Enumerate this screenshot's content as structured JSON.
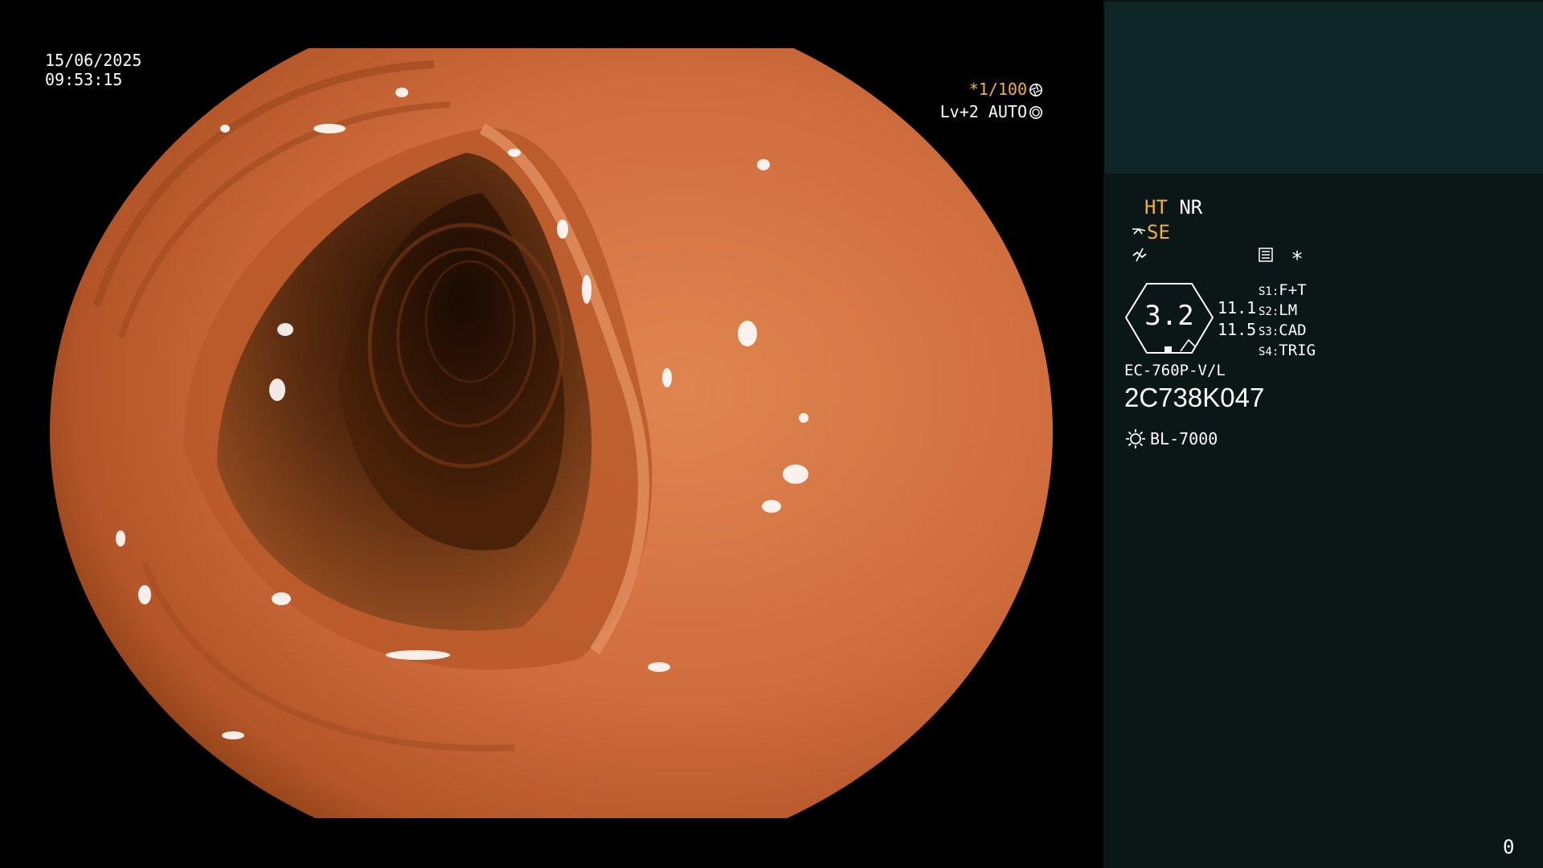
{
  "osd": {
    "date": "15/06/2025",
    "time": "09:53:15",
    "shutter": "*1/100",
    "level": "Lv+2 AUTO"
  },
  "panel": {
    "mode_ht": "HT",
    "mode_nr": "NR",
    "mode_se": "SE",
    "zoom": "3.2",
    "gain_top": "11.1",
    "gain_bottom": "11.5",
    "switches": [
      {
        "id": "S1:",
        "label": "F+T"
      },
      {
        "id": "S2:",
        "label": "LM"
      },
      {
        "id": "S3:",
        "label": "CAD"
      },
      {
        "id": "S4:",
        "label": "TRIG"
      }
    ],
    "star": "*",
    "scope_model": "EC-760P-V/L",
    "scope_serial": "2C738K047",
    "light_source": "BL-7000",
    "counter": "0"
  },
  "colors": {
    "accent_orange": "#f0b040",
    "panel_bg": "#0b1616",
    "thumb_bg": "#0f2626",
    "mucosa": "#d07040",
    "lumen": "#3a1a08"
  },
  "icons": [
    "shutter-icon",
    "auto-iris-icon",
    "hood-icon",
    "flicker-icon",
    "menu-icon",
    "light-source-icon"
  ]
}
